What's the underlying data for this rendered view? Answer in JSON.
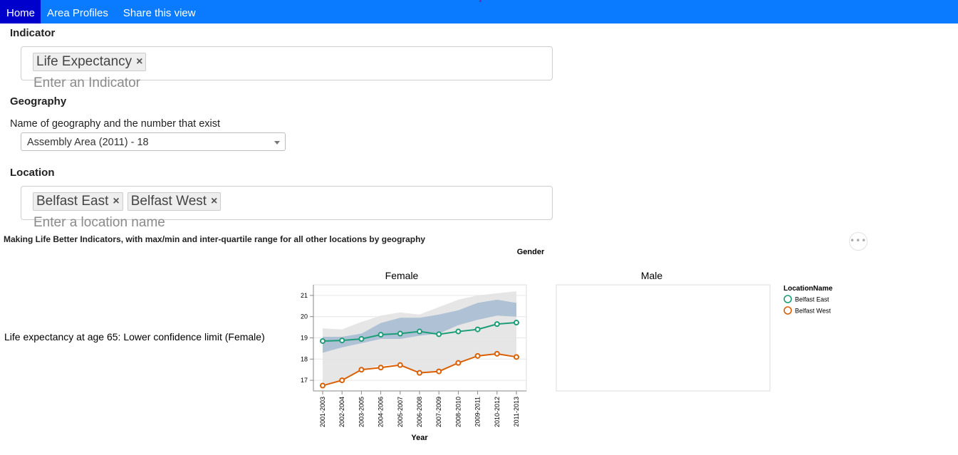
{
  "nav": {
    "items": [
      "Home",
      "Area Profiles",
      "Share this view"
    ]
  },
  "indicator": {
    "label": "Indicator",
    "tags": [
      {
        "text": "Life Expectancy"
      }
    ],
    "placeholder": "Enter an Indicator"
  },
  "geography": {
    "label": "Geography",
    "description": "Name of geography and the number that exist",
    "selected": "Assembly Area (2011) - 18"
  },
  "location": {
    "label": "Location",
    "tags": [
      {
        "text": "Belfast East"
      },
      {
        "text": "Belfast West"
      }
    ],
    "placeholder": "Enter a location name"
  },
  "chart": {
    "title": "Making Life Better Indicators, with max/min and inter-quartile range for all other locations by geography",
    "more_icon": "•••"
  },
  "chart_data": {
    "type": "line",
    "title": "Making Life Better Indicators, with max/min and inter-quartile range for all other locations by geography",
    "facet_header": "Gender",
    "facets": [
      "Female",
      "Male"
    ],
    "row_label": "Life expectancy at age 65: Lower confidence limit (Female)",
    "xlabel": "Year",
    "ylabel": "",
    "categories": [
      "2001-2003",
      "2002-2004",
      "2003-2005",
      "2004-2006",
      "2005-2007",
      "2006-2008",
      "2007-2009",
      "2008-2010",
      "2009-2011",
      "2010-2012",
      "2011-2013"
    ],
    "ylim": [
      16.5,
      21.5
    ],
    "yticks": [
      17,
      18,
      19,
      20,
      21
    ],
    "grid": true,
    "legend": {
      "title": "LocationName",
      "position": "right"
    },
    "series": [
      {
        "name": "Belfast East",
        "color": "#1b9e77",
        "facet": "Female",
        "values": [
          18.85,
          18.88,
          18.95,
          19.15,
          19.2,
          19.3,
          19.17,
          19.3,
          19.4,
          19.65,
          19.72
        ]
      },
      {
        "name": "Belfast West",
        "color": "#d95f02",
        "facet": "Female",
        "values": [
          16.75,
          17.0,
          17.5,
          17.6,
          17.72,
          17.35,
          17.42,
          17.82,
          18.15,
          18.25,
          18.1
        ]
      }
    ],
    "bands": {
      "minmax": {
        "color": "#e3e3e3",
        "facet": "Female",
        "low": [
          16.8,
          17.0,
          17.5,
          17.7,
          17.75,
          17.35,
          17.45,
          17.85,
          18.2,
          18.2,
          18.1
        ],
        "high": [
          19.45,
          19.4,
          19.75,
          20.05,
          20.2,
          20.1,
          20.45,
          20.8,
          21.0,
          21.1,
          21.2
        ]
      },
      "iqr": {
        "color": "#a9bdd1",
        "facet": "Female",
        "low": [
          18.3,
          18.55,
          18.75,
          18.95,
          18.95,
          19.1,
          19.2,
          19.6,
          19.85,
          20.05,
          20.0
        ],
        "high": [
          19.05,
          19.05,
          19.2,
          19.7,
          19.95,
          19.95,
          20.1,
          20.3,
          20.65,
          20.8,
          20.65
        ]
      }
    }
  }
}
